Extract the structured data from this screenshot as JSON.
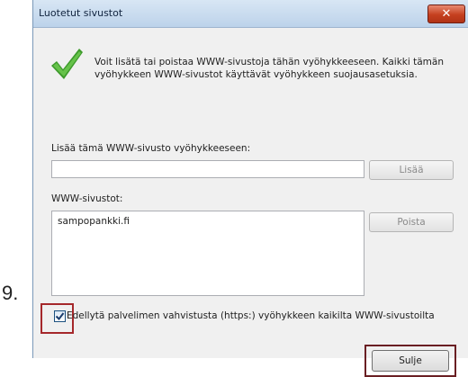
{
  "step_number": "9.",
  "dialog": {
    "title": "Luotetut sivustot",
    "close_glyph": "✕",
    "info_text": "Voit lisätä tai poistaa WWW-sivustoja tähän vyöhykkeeseen. Kaikki tämän vyöhykkeen WWW-sivustot käyttävät vyöhykkeen suojausasetuksia.",
    "add_label": "Lisää tämä WWW-sivusto vyöhykkeeseen:",
    "add_input_value": "",
    "add_button": "Lisää",
    "sites_label": "WWW-sivustot:",
    "sites": [
      "sampopankki.fi"
    ],
    "remove_button": "Poista",
    "require_https_label": "Edellytä palvelimen vahvistusta (https:) vyöhykkeen kaikilta WWW-sivustoilta",
    "require_https_checked": true,
    "close_button": "Sulje"
  },
  "icons": {
    "info": "checkmark-icon",
    "checkbox": "checkmark-icon"
  },
  "colors": {
    "highlight": "#a5282b",
    "close_button_red": "#c5401f",
    "check_green": "#3d9a2b"
  }
}
